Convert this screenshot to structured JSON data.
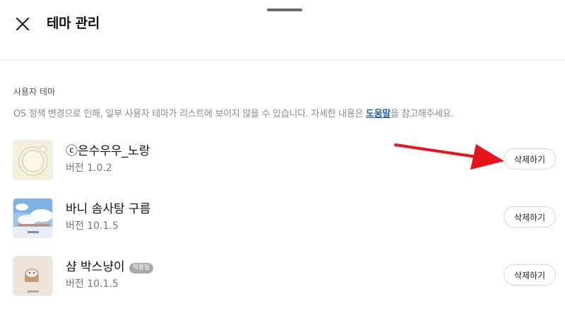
{
  "header": {
    "title": "테마 관리",
    "close_icon": "close-icon"
  },
  "section": {
    "label": "사용자 테마",
    "notice_before": "OS 정책 변경으로 인해, 일부 사용자 테마가 리스트에 보이지 않을 수 있습니다. 자세한 내용은 ",
    "notice_link": "도움말",
    "notice_after": "을 참고해주세요."
  },
  "themes": [
    {
      "name": "ⓒ은수우우_노랑",
      "version": "버전 1.0.2",
      "applied_badge": "",
      "delete_label": "삭제하기",
      "thumbnail_icon": "yellow-bubble-thumbnail"
    },
    {
      "name": "바니 솜사탕 구름",
      "version": "버전 10.1.5",
      "applied_badge": "",
      "delete_label": "삭제하기",
      "thumbnail_icon": "sky-cloud-thumbnail"
    },
    {
      "name": "샴 박스냥이",
      "version": "버전 10.1.5",
      "applied_badge": "적용됨",
      "delete_label": "삭제하기",
      "thumbnail_icon": "cat-box-thumbnail"
    }
  ],
  "colors": {
    "link": "#1a5fb4",
    "annotation_arrow": "#e8141c",
    "badge_bg": "#a9a9a9"
  }
}
